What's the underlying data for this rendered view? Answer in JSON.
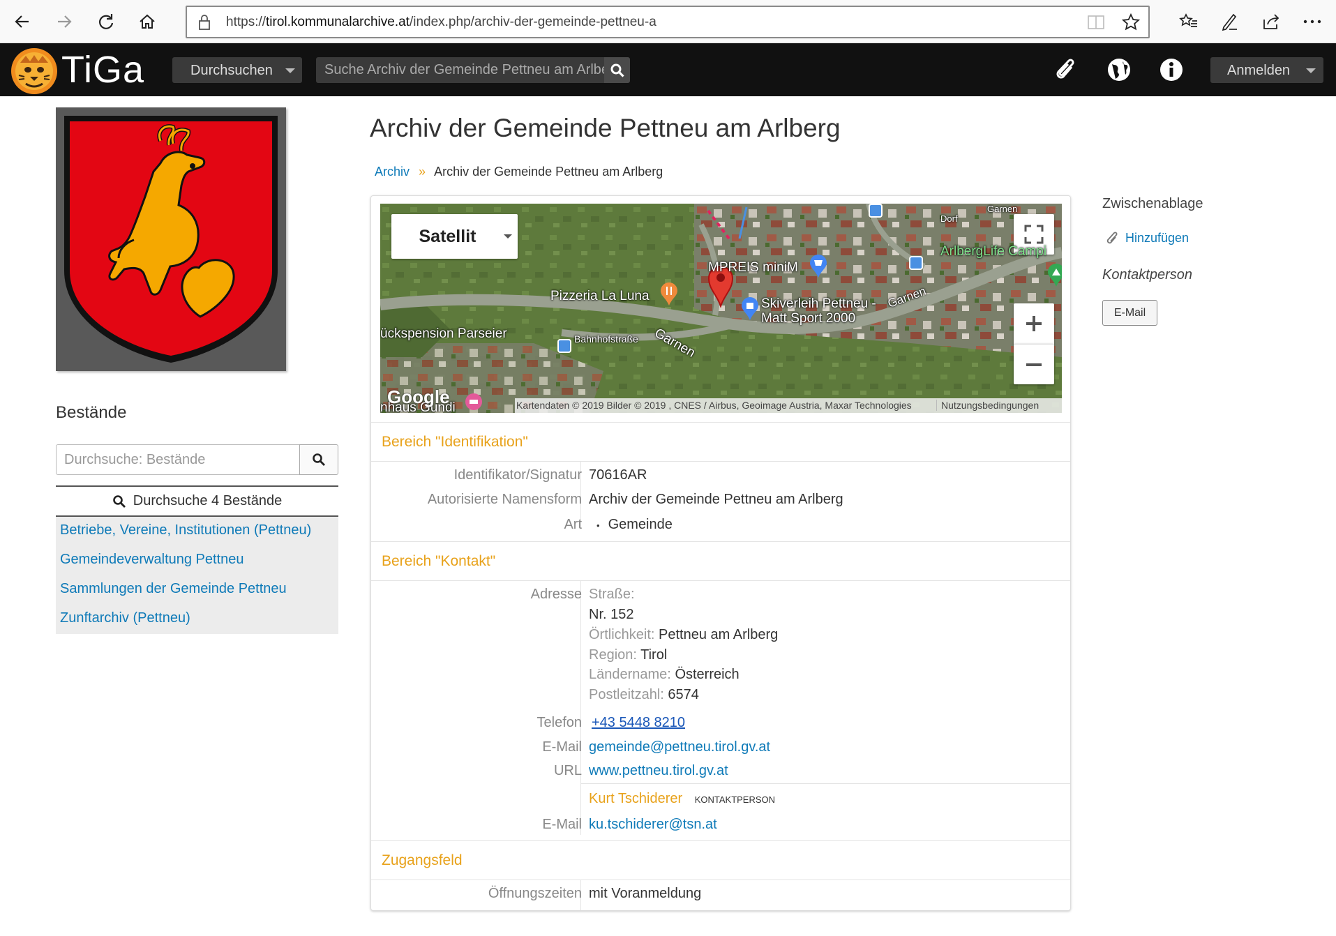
{
  "browser": {
    "url_prefix": "https://",
    "url_domain": "tirol.kommunalarchive.at",
    "url_path": "/index.php/archiv-der-gemeinde-pettneu-a"
  },
  "header": {
    "logo_text": "TiGa",
    "browse_label": "Durchsuchen",
    "search_placeholder": "Suche Archiv der Gemeinde Pettneu am Arlberg",
    "login_label": "Anmelden"
  },
  "sidebar": {
    "title": "Bestände",
    "search_placeholder": "Durchsuche: Bestände",
    "list_header": "Durchsuche 4 Bestände",
    "items": [
      "Betriebe, Vereine, Institutionen (Pettneu)",
      "Gemeindeverwaltung Pettneu",
      "Sammlungen der Gemeinde Pettneu",
      "Zunftarchiv (Pettneu)"
    ]
  },
  "main": {
    "title": "Archiv der Gemeinde Pettneu am Arlberg",
    "breadcrumb": {
      "root": "Archiv",
      "separator": "»",
      "current": "Archiv der Gemeinde Pettneu am Arlberg"
    },
    "map": {
      "type_button": "Satellit",
      "labels": [
        "Pizzeria La Luna",
        "MPREIS miniM",
        "Skiverleih Pettneu - Matt Sport 2000",
        "ückspension Parseier",
        "Bahnhofstraße",
        "Garnen",
        "Garnen",
        "ArlbergLife Campi",
        "Dorf",
        "Garnen",
        "nhaus Gundi"
      ],
      "google": "Google",
      "attribution": "Kartendaten © 2019 Bilder © 2019 , CNES / Airbus, Geoimage Austria, Maxar Technologies",
      "terms": "Nutzungsbedingungen"
    },
    "identification": {
      "heading": "Bereich \"Identifikation\"",
      "id_label": "Identifikator/Signatur",
      "id_value": "70616AR",
      "name_label": "Autorisierte Namensform",
      "name_value": "Archiv der Gemeinde Pettneu am Arlberg",
      "type_label": "Art",
      "type_value": "Gemeinde"
    },
    "contact": {
      "heading": "Bereich \"Kontakt\"",
      "address_label": "Adresse",
      "street_label": "Straße:",
      "street_value": "Nr. 152",
      "locality_label": "Örtlichkeit:",
      "locality_value": "Pettneu am Arlberg",
      "region_label": "Region:",
      "region_value": "Tirol",
      "country_label": "Ländername:",
      "country_value": "Österreich",
      "postal_label": "Postleitzahl:",
      "postal_value": "6574",
      "phone_label": "Telefon",
      "phone_value": "+43 5448 8210",
      "email_label": "E-Mail",
      "email_value": "gemeinde@pettneu.tirol.gv.at",
      "url_label": "URL",
      "url_value": "www.pettneu.tirol.gv.at",
      "person_name": "Kurt Tschiderer",
      "person_role": "KONTAKTPERSON",
      "person_email_label": "E-Mail",
      "person_email_value": "ku.tschiderer@tsn.at"
    },
    "access": {
      "heading": "Zugangsfeld",
      "hours_label": "Öffnungszeiten",
      "hours_value": "mit Voranmeldung"
    }
  },
  "right": {
    "clipboard_title": "Zwischenablage",
    "clipboard_add": "Hinzufügen",
    "contact_title": "Kontaktperson",
    "email_button": "E-Mail"
  },
  "colors": {
    "accent": "#e8a21b",
    "link": "#0e7ab8",
    "topbar": "#111111",
    "coat_red": "#e30613",
    "coat_gold": "#f5a800"
  }
}
